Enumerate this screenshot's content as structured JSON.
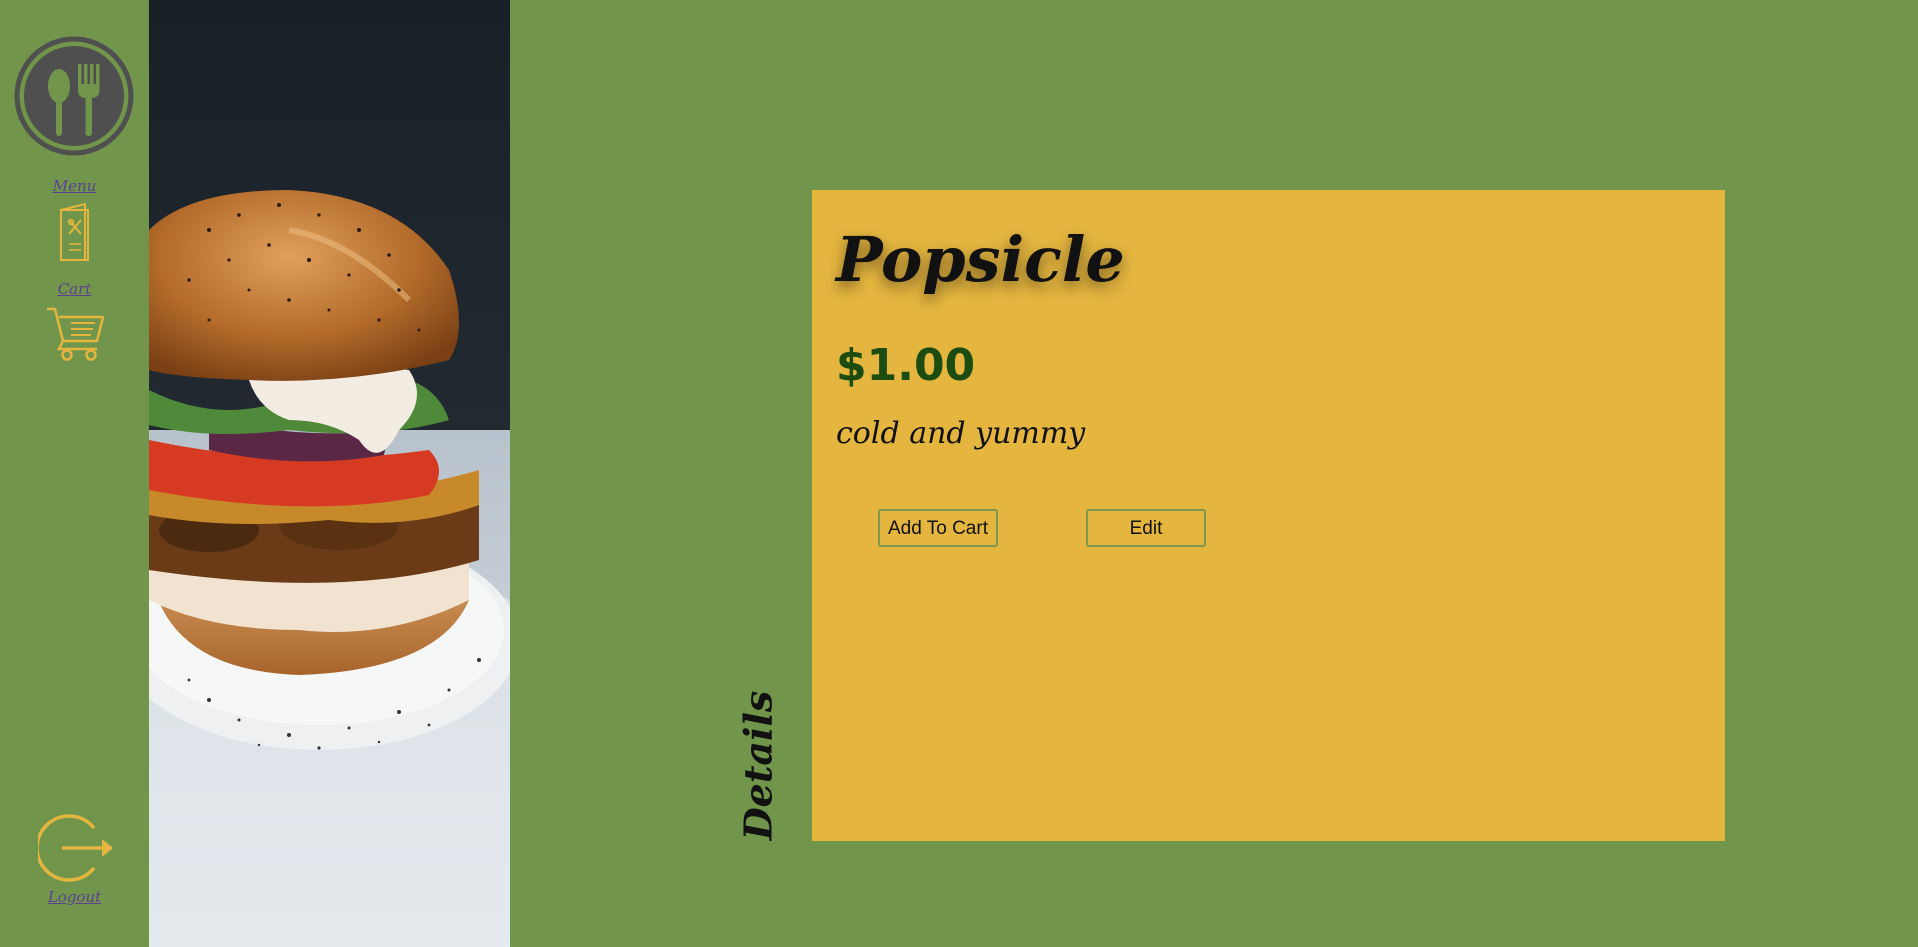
{
  "sidebar": {
    "logo_icon": "spoon-fork-icon",
    "menu_label": "Menu",
    "menu_icon": "menu-booklet-icon",
    "cart_label": "Cart",
    "cart_icon": "cart-icon",
    "logout_label": "Logout",
    "logout_icon": "logout-icon"
  },
  "hero": {
    "image": "burger-photo"
  },
  "section": {
    "label": "Details"
  },
  "item": {
    "name": "Popsicle",
    "price": "$1.00",
    "description": "cold and yummy"
  },
  "actions": {
    "add_to_cart_label": "Add To Cart",
    "edit_label": "Edit"
  },
  "colors": {
    "background": "#71964b",
    "card": "#e4b53f",
    "accent_icon": "#e4b53f",
    "logo": "#4f4f4f",
    "price": "#1c4c0f",
    "link": "#5c3f8f"
  }
}
